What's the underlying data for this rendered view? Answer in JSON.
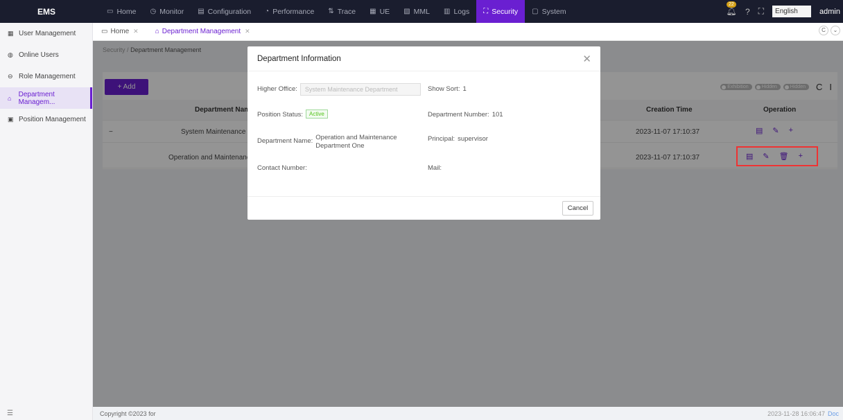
{
  "app": {
    "title": "EMS",
    "user": "admin",
    "notifications": "22",
    "language": "English"
  },
  "nav": [
    {
      "label": "Home",
      "icon": "monitor-icon",
      "glyph": "▭"
    },
    {
      "label": "Monitor",
      "icon": "clock-icon",
      "glyph": "◷"
    },
    {
      "label": "Configuration",
      "icon": "config-icon",
      "glyph": "▤"
    },
    {
      "label": "Performance",
      "icon": "gauge-icon",
      "glyph": "◔"
    },
    {
      "label": "Trace",
      "icon": "trace-icon",
      "glyph": "⇅"
    },
    {
      "label": "UE",
      "icon": "ue-icon",
      "glyph": "▦"
    },
    {
      "label": "MML",
      "icon": "mml-icon",
      "glyph": "▧"
    },
    {
      "label": "Logs",
      "icon": "logs-icon",
      "glyph": "▥"
    },
    {
      "label": "Security",
      "icon": "security-icon",
      "glyph": "⛶"
    },
    {
      "label": "System",
      "icon": "folder-icon",
      "glyph": "▢"
    }
  ],
  "sidebar": [
    {
      "label": "User Management",
      "glyph": "▦"
    },
    {
      "label": "Online Users",
      "glyph": "◍"
    },
    {
      "label": "Role Management",
      "glyph": "⊖"
    },
    {
      "label": "Department Managem...",
      "glyph": "⌂"
    },
    {
      "label": "Position Management",
      "glyph": "▣"
    }
  ],
  "tabs": [
    {
      "label": "Home"
    },
    {
      "label": "Department Management"
    }
  ],
  "breadcrumb": {
    "parent": "Security",
    "sep": "/",
    "current": "Department Management"
  },
  "toolbar": {
    "add_label": "+ Add",
    "toggles": [
      "Exhibition",
      "Hidden",
      "Hidden"
    ]
  },
  "table": {
    "headers": [
      "Department Name",
      "Creation Time",
      "Operation"
    ],
    "rows": [
      {
        "expander": "−",
        "name": "System Maintenance De",
        "created": "2023-11-07 17:10:37"
      },
      {
        "expander": "",
        "name": "Operation and Maintenance I",
        "created": "2023-11-07 17:10:37"
      }
    ]
  },
  "modal": {
    "title": "Department Information",
    "higher_office_label": "Higher Office:",
    "higher_office_value": "System Maintenance Department",
    "show_sort_label": "Show Sort:",
    "show_sort_value": "1",
    "position_status_label": "Position Status:",
    "position_status_value": "Active",
    "dept_number_label": "Department Number:",
    "dept_number_value": "101",
    "dept_name_label": "Department Name:",
    "dept_name_value": "Operation and Maintenance Department One",
    "principal_label": "Principal:",
    "principal_value": "supervisor",
    "contact_label": "Contact Number:",
    "mail_label": "Mail:",
    "cancel_label": "Cancel"
  },
  "footer": {
    "copyright": "Copyright ©2023 for",
    "time": "2023-11-28 16:06:47",
    "doc": "Doc"
  },
  "colors": {
    "accent": "#6a1fd1",
    "topbar": "#1a1d2e",
    "highlight": "#ee3333"
  }
}
